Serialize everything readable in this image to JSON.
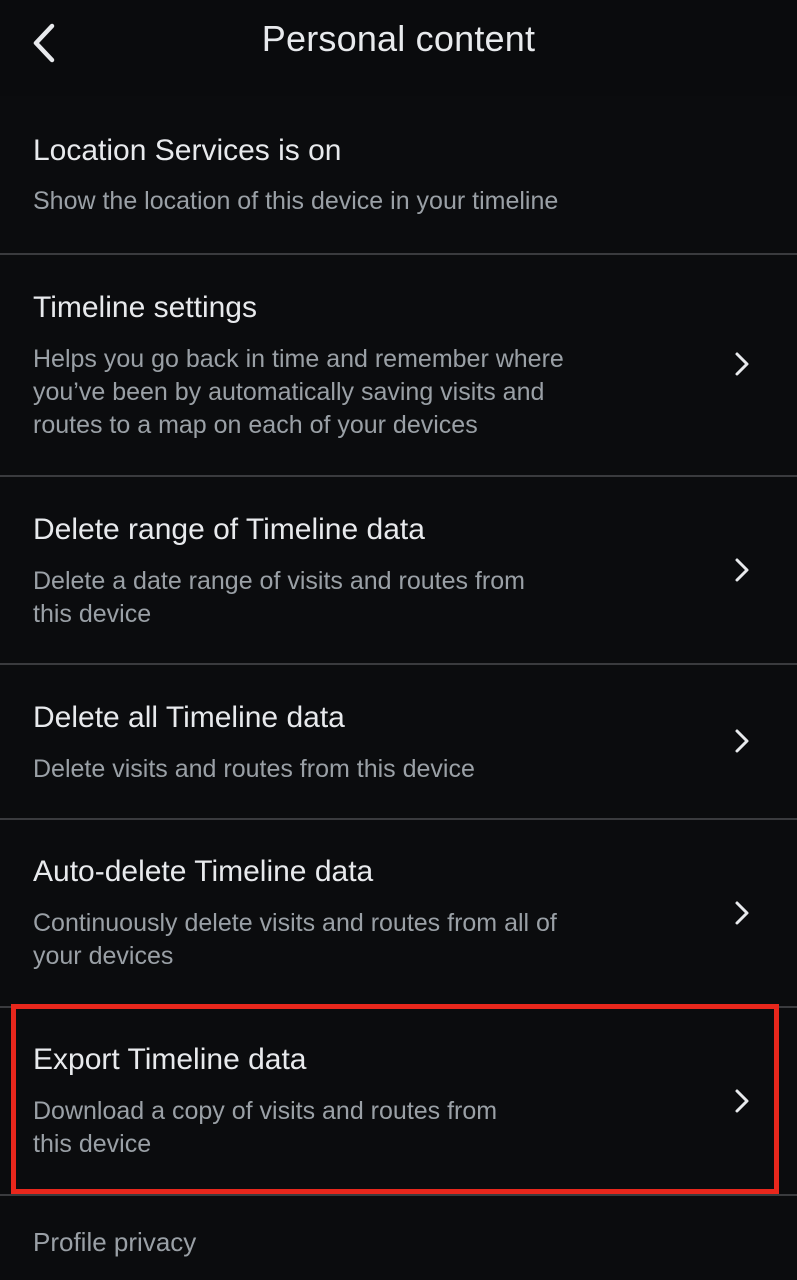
{
  "header": {
    "title": "Personal content",
    "back_icon": "chevron-left-icon"
  },
  "rows": [
    {
      "title": "Location Services is on",
      "subtitle": "Show the location of this device in your timeline",
      "has_chevron": false
    },
    {
      "title": "Timeline settings",
      "subtitle": "Helps you go back in time and remember where\nyou’ve been by automatically saving visits and\nroutes to a map on each of your devices",
      "has_chevron": true
    },
    {
      "title": "Delete range of Timeline data",
      "subtitle": "Delete a date range of visits and routes from\nthis device",
      "has_chevron": true
    },
    {
      "title": "Delete all Timeline data",
      "subtitle": "Delete visits and routes from this device",
      "has_chevron": true
    },
    {
      "title": "Auto-delete Timeline data",
      "subtitle": "Continuously delete visits and routes from all of\nyour devices",
      "has_chevron": true
    },
    {
      "title": "Export Timeline data",
      "subtitle": "Download a copy of visits and routes from\nthis device",
      "has_chevron": true,
      "highlighted": true
    }
  ],
  "section": {
    "label": "Profile privacy"
  },
  "colors": {
    "background": "#0b0c0e",
    "title_text": "#e8eaed",
    "subtitle_text": "#9aa0a6",
    "divider": "#3a3b3e",
    "highlight": "#e8271c"
  }
}
